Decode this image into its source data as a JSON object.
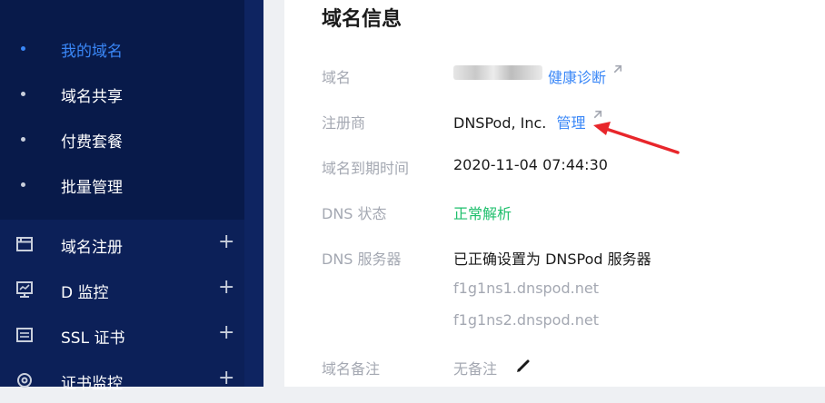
{
  "sidebar": {
    "submenu": [
      {
        "label": "我的域名",
        "active": true
      },
      {
        "label": "域名共享",
        "active": false
      },
      {
        "label": "付费套餐",
        "active": false
      },
      {
        "label": "批量管理",
        "active": false
      }
    ],
    "menu": [
      {
        "label": "域名注册",
        "icon": "browser-window-icon"
      },
      {
        "label": "D 监控",
        "icon": "monitor-icon"
      },
      {
        "label": "SSL 证书",
        "icon": "certificate-icon"
      },
      {
        "label": "证书监控",
        "icon": "target-icon"
      }
    ],
    "expand_symbol": "+"
  },
  "main": {
    "title": "域名信息",
    "rows": {
      "domain": {
        "label": "域名",
        "link": "健康诊断"
      },
      "registrar": {
        "label": "注册商",
        "value": "DNSPod, Inc.",
        "link": "管理"
      },
      "expiry": {
        "label": "域名到期时间",
        "value": "2020-11-04 07:44:30"
      },
      "dns_status": {
        "label": "DNS 状态",
        "value": "正常解析"
      },
      "dns_servers": {
        "label": "DNS 服务器",
        "value": "已正确设置为 DNSPod 服务器",
        "servers": [
          "f1g1ns1.dnspod.net",
          "f1g1ns2.dnspod.net"
        ]
      },
      "remark": {
        "label": "域名备注",
        "value": "无备注"
      }
    }
  },
  "colors": {
    "sidebar_bg": "#0c2058",
    "submenu_bg": "#081a4a",
    "accent": "#3a87f7",
    "status_ok": "#1ebf6c",
    "annotation": "#e8262b"
  }
}
